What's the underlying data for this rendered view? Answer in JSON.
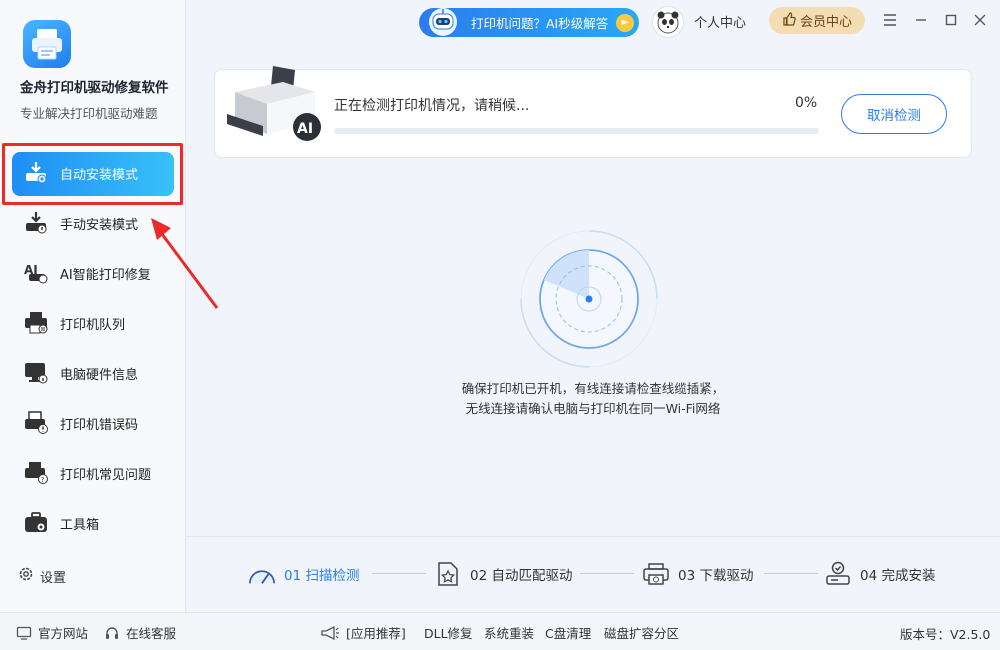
{
  "app": {
    "name": "金舟打印机驱动修复软件",
    "subtitle": "专业解决打印机驱动难题"
  },
  "titlebar": {
    "ai_banner": "打印机问题？AI秒级解答",
    "personal_center": "个人中心",
    "vip_center": "会员中心"
  },
  "sidebar": {
    "items": [
      {
        "label": "自动安装模式",
        "icon": "auto-install-icon"
      },
      {
        "label": "手动安装模式",
        "icon": "manual-install-icon"
      },
      {
        "label": "AI智能打印修复",
        "icon": "ai-repair-icon"
      },
      {
        "label": "打印机队列",
        "icon": "printer-queue-icon"
      },
      {
        "label": "电脑硬件信息",
        "icon": "hardware-info-icon"
      },
      {
        "label": "打印机错误码",
        "icon": "error-code-icon"
      },
      {
        "label": "打印机常见问题",
        "icon": "faq-icon"
      },
      {
        "label": "工具箱",
        "icon": "toolbox-icon"
      }
    ],
    "settings": "设置"
  },
  "scan": {
    "status": "正在检测打印机情况，请稍候...",
    "percent_text": "0%",
    "progress": 0,
    "cancel": "取消检测"
  },
  "hints": {
    "line1": "确保打印机已开机，有线连接请检查线缆插紧，",
    "line2": "无线连接请确认电脑与打印机在同一Wi-Fi网络"
  },
  "steps": [
    {
      "label": "01 扫描检测"
    },
    {
      "label": "02 自动匹配驱动"
    },
    {
      "label": "03 下载驱动"
    },
    {
      "label": "04 完成安装"
    }
  ],
  "footer": {
    "official_site": "官方网站",
    "online_service": "在线客服",
    "recommend": "[应用推荐]",
    "links": [
      "DLL修复",
      "系统重装",
      "C盘清理",
      "磁盘扩容分区"
    ],
    "version": "版本号：V2.5.0"
  },
  "colors": {
    "accent": "#2a7cf0",
    "highlight": "#ec2a2a",
    "vip": "#f4ddb2"
  }
}
